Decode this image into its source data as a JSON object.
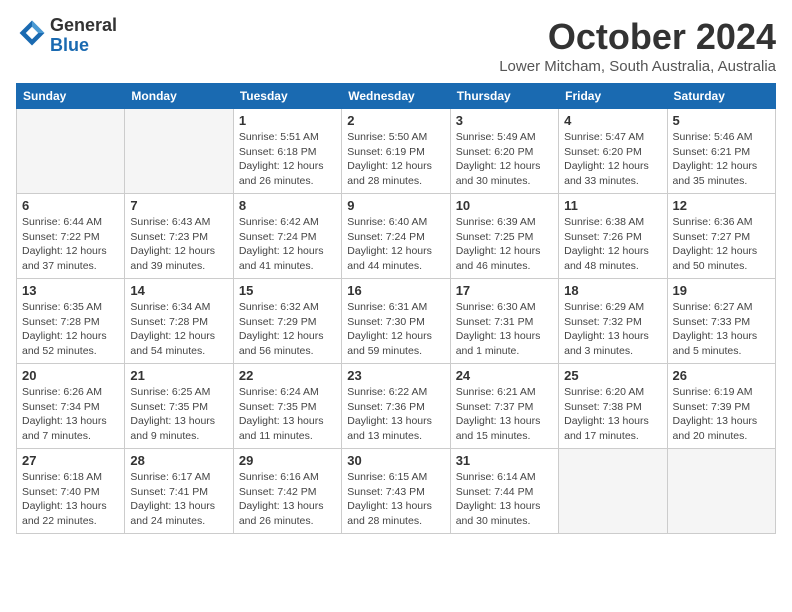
{
  "header": {
    "logo_general": "General",
    "logo_blue": "Blue",
    "month": "October 2024",
    "location": "Lower Mitcham, South Australia, Australia"
  },
  "days_of_week": [
    "Sunday",
    "Monday",
    "Tuesday",
    "Wednesday",
    "Thursday",
    "Friday",
    "Saturday"
  ],
  "weeks": [
    [
      {
        "day": "",
        "info": ""
      },
      {
        "day": "",
        "info": ""
      },
      {
        "day": "1",
        "info": "Sunrise: 5:51 AM\nSunset: 6:18 PM\nDaylight: 12 hours\nand 26 minutes."
      },
      {
        "day": "2",
        "info": "Sunrise: 5:50 AM\nSunset: 6:19 PM\nDaylight: 12 hours\nand 28 minutes."
      },
      {
        "day": "3",
        "info": "Sunrise: 5:49 AM\nSunset: 6:20 PM\nDaylight: 12 hours\nand 30 minutes."
      },
      {
        "day": "4",
        "info": "Sunrise: 5:47 AM\nSunset: 6:20 PM\nDaylight: 12 hours\nand 33 minutes."
      },
      {
        "day": "5",
        "info": "Sunrise: 5:46 AM\nSunset: 6:21 PM\nDaylight: 12 hours\nand 35 minutes."
      }
    ],
    [
      {
        "day": "6",
        "info": "Sunrise: 6:44 AM\nSunset: 7:22 PM\nDaylight: 12 hours\nand 37 minutes."
      },
      {
        "day": "7",
        "info": "Sunrise: 6:43 AM\nSunset: 7:23 PM\nDaylight: 12 hours\nand 39 minutes."
      },
      {
        "day": "8",
        "info": "Sunrise: 6:42 AM\nSunset: 7:24 PM\nDaylight: 12 hours\nand 41 minutes."
      },
      {
        "day": "9",
        "info": "Sunrise: 6:40 AM\nSunset: 7:24 PM\nDaylight: 12 hours\nand 44 minutes."
      },
      {
        "day": "10",
        "info": "Sunrise: 6:39 AM\nSunset: 7:25 PM\nDaylight: 12 hours\nand 46 minutes."
      },
      {
        "day": "11",
        "info": "Sunrise: 6:38 AM\nSunset: 7:26 PM\nDaylight: 12 hours\nand 48 minutes."
      },
      {
        "day": "12",
        "info": "Sunrise: 6:36 AM\nSunset: 7:27 PM\nDaylight: 12 hours\nand 50 minutes."
      }
    ],
    [
      {
        "day": "13",
        "info": "Sunrise: 6:35 AM\nSunset: 7:28 PM\nDaylight: 12 hours\nand 52 minutes."
      },
      {
        "day": "14",
        "info": "Sunrise: 6:34 AM\nSunset: 7:28 PM\nDaylight: 12 hours\nand 54 minutes."
      },
      {
        "day": "15",
        "info": "Sunrise: 6:32 AM\nSunset: 7:29 PM\nDaylight: 12 hours\nand 56 minutes."
      },
      {
        "day": "16",
        "info": "Sunrise: 6:31 AM\nSunset: 7:30 PM\nDaylight: 12 hours\nand 59 minutes."
      },
      {
        "day": "17",
        "info": "Sunrise: 6:30 AM\nSunset: 7:31 PM\nDaylight: 13 hours\nand 1 minute."
      },
      {
        "day": "18",
        "info": "Sunrise: 6:29 AM\nSunset: 7:32 PM\nDaylight: 13 hours\nand 3 minutes."
      },
      {
        "day": "19",
        "info": "Sunrise: 6:27 AM\nSunset: 7:33 PM\nDaylight: 13 hours\nand 5 minutes."
      }
    ],
    [
      {
        "day": "20",
        "info": "Sunrise: 6:26 AM\nSunset: 7:34 PM\nDaylight: 13 hours\nand 7 minutes."
      },
      {
        "day": "21",
        "info": "Sunrise: 6:25 AM\nSunset: 7:35 PM\nDaylight: 13 hours\nand 9 minutes."
      },
      {
        "day": "22",
        "info": "Sunrise: 6:24 AM\nSunset: 7:35 PM\nDaylight: 13 hours\nand 11 minutes."
      },
      {
        "day": "23",
        "info": "Sunrise: 6:22 AM\nSunset: 7:36 PM\nDaylight: 13 hours\nand 13 minutes."
      },
      {
        "day": "24",
        "info": "Sunrise: 6:21 AM\nSunset: 7:37 PM\nDaylight: 13 hours\nand 15 minutes."
      },
      {
        "day": "25",
        "info": "Sunrise: 6:20 AM\nSunset: 7:38 PM\nDaylight: 13 hours\nand 17 minutes."
      },
      {
        "day": "26",
        "info": "Sunrise: 6:19 AM\nSunset: 7:39 PM\nDaylight: 13 hours\nand 20 minutes."
      }
    ],
    [
      {
        "day": "27",
        "info": "Sunrise: 6:18 AM\nSunset: 7:40 PM\nDaylight: 13 hours\nand 22 minutes."
      },
      {
        "day": "28",
        "info": "Sunrise: 6:17 AM\nSunset: 7:41 PM\nDaylight: 13 hours\nand 24 minutes."
      },
      {
        "day": "29",
        "info": "Sunrise: 6:16 AM\nSunset: 7:42 PM\nDaylight: 13 hours\nand 26 minutes."
      },
      {
        "day": "30",
        "info": "Sunrise: 6:15 AM\nSunset: 7:43 PM\nDaylight: 13 hours\nand 28 minutes."
      },
      {
        "day": "31",
        "info": "Sunrise: 6:14 AM\nSunset: 7:44 PM\nDaylight: 13 hours\nand 30 minutes."
      },
      {
        "day": "",
        "info": ""
      },
      {
        "day": "",
        "info": ""
      }
    ]
  ]
}
